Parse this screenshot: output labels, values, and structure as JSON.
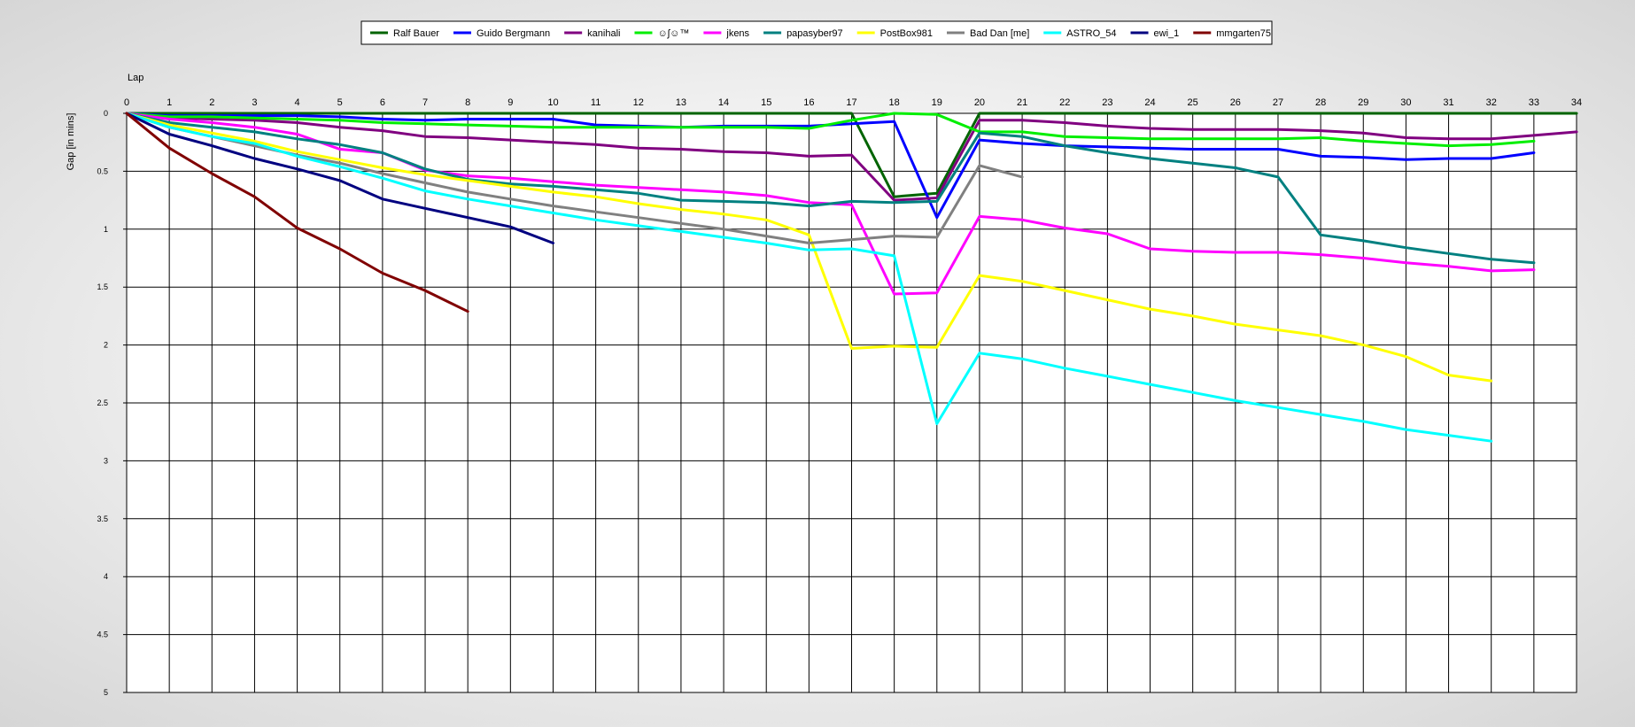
{
  "chart_data": {
    "type": "line",
    "title": "",
    "xlabel": "Lap",
    "ylabel": "Gap [in mins]",
    "x": [
      0,
      1,
      2,
      3,
      4,
      5,
      6,
      7,
      8,
      9,
      10,
      11,
      12,
      13,
      14,
      15,
      16,
      17,
      18,
      19,
      20,
      21,
      22,
      23,
      24,
      25,
      26,
      27,
      28,
      29,
      30,
      31,
      32,
      33,
      34
    ],
    "xlim": [
      0,
      34
    ],
    "ylim": [
      0,
      5
    ],
    "y_inverted": true,
    "x_axis_position": "top",
    "y_ticks": [
      "0",
      "0.5",
      "1",
      "1.5",
      "2",
      "2.5",
      "3",
      "3.5",
      "4",
      "4.5",
      "5"
    ],
    "grid": true,
    "legend_position": "top-center",
    "series": [
      {
        "name": "Ralf Bauer",
        "color": "#006400",
        "values": [
          0,
          0,
          0,
          0,
          0,
          0,
          0,
          0,
          0,
          0,
          0,
          0,
          0,
          0,
          0,
          0,
          0,
          0,
          0.72,
          0.69,
          0,
          0,
          0,
          0,
          0,
          0,
          0,
          0,
          0,
          0,
          0,
          0,
          0,
          0,
          0
        ]
      },
      {
        "name": "Guido Bergmann",
        "color": "#0000ff",
        "values": [
          0,
          0.02,
          0.02,
          0.02,
          0.02,
          0.03,
          0.05,
          0.06,
          0.05,
          0.05,
          0.05,
          0.1,
          0.11,
          0.12,
          0.11,
          0.11,
          0.11,
          0.09,
          0.07,
          0.9,
          0.23,
          0.26,
          0.28,
          0.29,
          0.3,
          0.31,
          0.31,
          0.31,
          0.37,
          0.38,
          0.4,
          0.39,
          0.39,
          0.34,
          null
        ]
      },
      {
        "name": "kanihali",
        "color": "#800080",
        "values": [
          0,
          0.04,
          0.05,
          0.06,
          0.08,
          0.12,
          0.15,
          0.2,
          0.21,
          0.23,
          0.25,
          0.27,
          0.3,
          0.31,
          0.33,
          0.34,
          0.37,
          0.36,
          0.75,
          0.73,
          0.06,
          0.06,
          0.08,
          0.11,
          0.13,
          0.14,
          0.14,
          0.14,
          0.15,
          0.17,
          0.21,
          0.22,
          0.22,
          0.19,
          0.16
        ]
      },
      {
        "name": "☺ʃ☺™",
        "color": "#00ee00",
        "values": [
          0,
          0.03,
          0.03,
          0.04,
          0.05,
          0.06,
          0.08,
          0.09,
          0.1,
          0.11,
          0.12,
          0.12,
          0.12,
          0.12,
          0.12,
          0.12,
          0.13,
          0.06,
          0,
          0.01,
          0.16,
          0.16,
          0.2,
          0.21,
          0.22,
          0.22,
          0.22,
          0.22,
          0.21,
          0.24,
          0.26,
          0.28,
          0.27,
          0.24,
          null
        ]
      },
      {
        "name": "jkens",
        "color": "#ff00ff",
        "values": [
          0,
          0.05,
          0.08,
          0.12,
          0.18,
          0.31,
          0.34,
          0.49,
          0.54,
          0.56,
          0.59,
          0.62,
          0.64,
          0.66,
          0.68,
          0.71,
          0.77,
          0.79,
          1.56,
          1.55,
          0.89,
          0.92,
          0.99,
          1.04,
          1.17,
          1.19,
          1.2,
          1.2,
          1.22,
          1.25,
          1.29,
          1.32,
          1.36,
          1.35,
          null
        ]
      },
      {
        "name": "papasyber97",
        "color": "#008080",
        "values": [
          0,
          0.08,
          0.12,
          0.16,
          0.22,
          0.27,
          0.34,
          0.48,
          0.57,
          0.61,
          0.63,
          0.66,
          0.69,
          0.75,
          0.76,
          0.77,
          0.8,
          0.76,
          0.77,
          0.76,
          0.17,
          0.2,
          0.28,
          0.34,
          0.39,
          0.43,
          0.47,
          0.55,
          1.05,
          1.1,
          1.16,
          1.21,
          1.26,
          1.29,
          null
        ]
      },
      {
        "name": "PostBox981",
        "color": "#ffff00",
        "values": [
          0,
          0.1,
          0.17,
          0.24,
          0.33,
          0.4,
          0.47,
          0.53,
          0.58,
          0.63,
          0.68,
          0.72,
          0.78,
          0.83,
          0.87,
          0.92,
          1.05,
          2.03,
          2.01,
          2.02,
          1.4,
          1.45,
          1.53,
          1.61,
          1.69,
          1.75,
          1.82,
          1.87,
          1.92,
          2.0,
          2.1,
          2.26,
          2.31,
          null,
          null
        ]
      },
      {
        "name": "Bad Dan [me]",
        "color": "#808080",
        "values": [
          0,
          0.12,
          0.2,
          0.28,
          0.36,
          0.43,
          0.52,
          0.6,
          0.68,
          0.74,
          0.8,
          0.85,
          0.9,
          0.95,
          1.0,
          1.06,
          1.12,
          1.09,
          1.06,
          1.07,
          0.45,
          0.55,
          null,
          null,
          null,
          null,
          null,
          null,
          null,
          null,
          null,
          null,
          null,
          null,
          null
        ]
      },
      {
        "name": "ASTRO_54",
        "color": "#00ffff",
        "values": [
          0,
          0.12,
          0.2,
          0.26,
          0.37,
          0.46,
          0.56,
          0.67,
          0.74,
          0.8,
          0.86,
          0.92,
          0.97,
          1.02,
          1.07,
          1.12,
          1.18,
          1.17,
          1.23,
          2.68,
          2.07,
          2.12,
          2.2,
          2.27,
          2.34,
          2.41,
          2.48,
          2.54,
          2.6,
          2.66,
          2.73,
          2.78,
          2.83,
          null,
          null
        ]
      },
      {
        "name": "ewi_1",
        "color": "#000080",
        "values": [
          0,
          0.18,
          0.28,
          0.39,
          0.48,
          0.58,
          0.74,
          0.82,
          0.9,
          0.98,
          1.12,
          null,
          null,
          null,
          null,
          null,
          null,
          null,
          null,
          null,
          null,
          null,
          null,
          null,
          null,
          null,
          null,
          null,
          null,
          null,
          null,
          null,
          null,
          null,
          null
        ]
      },
      {
        "name": "mmgarten75",
        "color": "#800000",
        "values": [
          0,
          0.3,
          0.52,
          0.72,
          0.99,
          1.17,
          1.38,
          1.53,
          1.71,
          null,
          null,
          null,
          null,
          null,
          null,
          null,
          null,
          null,
          null,
          null,
          null,
          null,
          null,
          null,
          null,
          null,
          null,
          null,
          null,
          null,
          null,
          null,
          null,
          null,
          null
        ]
      }
    ]
  }
}
